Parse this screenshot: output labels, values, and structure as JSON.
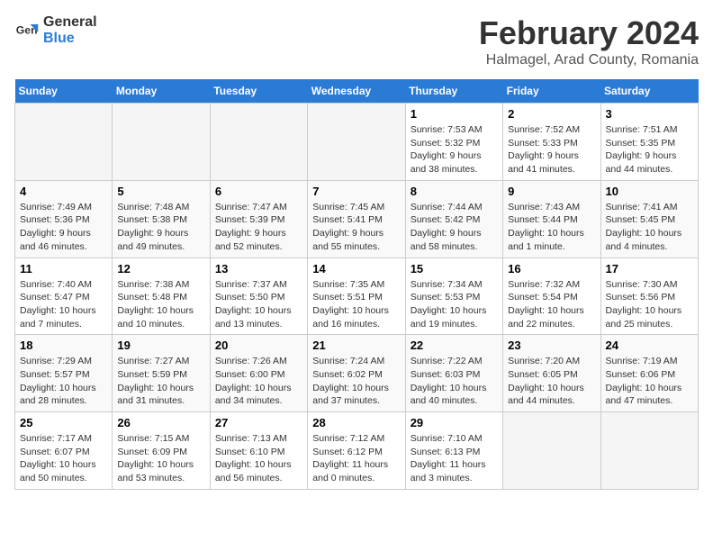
{
  "logo": {
    "line1": "General",
    "line2": "Blue"
  },
  "title": "February 2024",
  "subtitle": "Halmagel, Arad County, Romania",
  "days_of_week": [
    "Sunday",
    "Monday",
    "Tuesday",
    "Wednesday",
    "Thursday",
    "Friday",
    "Saturday"
  ],
  "weeks": [
    [
      {
        "day": "",
        "info": ""
      },
      {
        "day": "",
        "info": ""
      },
      {
        "day": "",
        "info": ""
      },
      {
        "day": "",
        "info": ""
      },
      {
        "day": "1",
        "info": "Sunrise: 7:53 AM\nSunset: 5:32 PM\nDaylight: 9 hours and 38 minutes."
      },
      {
        "day": "2",
        "info": "Sunrise: 7:52 AM\nSunset: 5:33 PM\nDaylight: 9 hours and 41 minutes."
      },
      {
        "day": "3",
        "info": "Sunrise: 7:51 AM\nSunset: 5:35 PM\nDaylight: 9 hours and 44 minutes."
      }
    ],
    [
      {
        "day": "4",
        "info": "Sunrise: 7:49 AM\nSunset: 5:36 PM\nDaylight: 9 hours and 46 minutes."
      },
      {
        "day": "5",
        "info": "Sunrise: 7:48 AM\nSunset: 5:38 PM\nDaylight: 9 hours and 49 minutes."
      },
      {
        "day": "6",
        "info": "Sunrise: 7:47 AM\nSunset: 5:39 PM\nDaylight: 9 hours and 52 minutes."
      },
      {
        "day": "7",
        "info": "Sunrise: 7:45 AM\nSunset: 5:41 PM\nDaylight: 9 hours and 55 minutes."
      },
      {
        "day": "8",
        "info": "Sunrise: 7:44 AM\nSunset: 5:42 PM\nDaylight: 9 hours and 58 minutes."
      },
      {
        "day": "9",
        "info": "Sunrise: 7:43 AM\nSunset: 5:44 PM\nDaylight: 10 hours and 1 minute."
      },
      {
        "day": "10",
        "info": "Sunrise: 7:41 AM\nSunset: 5:45 PM\nDaylight: 10 hours and 4 minutes."
      }
    ],
    [
      {
        "day": "11",
        "info": "Sunrise: 7:40 AM\nSunset: 5:47 PM\nDaylight: 10 hours and 7 minutes."
      },
      {
        "day": "12",
        "info": "Sunrise: 7:38 AM\nSunset: 5:48 PM\nDaylight: 10 hours and 10 minutes."
      },
      {
        "day": "13",
        "info": "Sunrise: 7:37 AM\nSunset: 5:50 PM\nDaylight: 10 hours and 13 minutes."
      },
      {
        "day": "14",
        "info": "Sunrise: 7:35 AM\nSunset: 5:51 PM\nDaylight: 10 hours and 16 minutes."
      },
      {
        "day": "15",
        "info": "Sunrise: 7:34 AM\nSunset: 5:53 PM\nDaylight: 10 hours and 19 minutes."
      },
      {
        "day": "16",
        "info": "Sunrise: 7:32 AM\nSunset: 5:54 PM\nDaylight: 10 hours and 22 minutes."
      },
      {
        "day": "17",
        "info": "Sunrise: 7:30 AM\nSunset: 5:56 PM\nDaylight: 10 hours and 25 minutes."
      }
    ],
    [
      {
        "day": "18",
        "info": "Sunrise: 7:29 AM\nSunset: 5:57 PM\nDaylight: 10 hours and 28 minutes."
      },
      {
        "day": "19",
        "info": "Sunrise: 7:27 AM\nSunset: 5:59 PM\nDaylight: 10 hours and 31 minutes."
      },
      {
        "day": "20",
        "info": "Sunrise: 7:26 AM\nSunset: 6:00 PM\nDaylight: 10 hours and 34 minutes."
      },
      {
        "day": "21",
        "info": "Sunrise: 7:24 AM\nSunset: 6:02 PM\nDaylight: 10 hours and 37 minutes."
      },
      {
        "day": "22",
        "info": "Sunrise: 7:22 AM\nSunset: 6:03 PM\nDaylight: 10 hours and 40 minutes."
      },
      {
        "day": "23",
        "info": "Sunrise: 7:20 AM\nSunset: 6:05 PM\nDaylight: 10 hours and 44 minutes."
      },
      {
        "day": "24",
        "info": "Sunrise: 7:19 AM\nSunset: 6:06 PM\nDaylight: 10 hours and 47 minutes."
      }
    ],
    [
      {
        "day": "25",
        "info": "Sunrise: 7:17 AM\nSunset: 6:07 PM\nDaylight: 10 hours and 50 minutes."
      },
      {
        "day": "26",
        "info": "Sunrise: 7:15 AM\nSunset: 6:09 PM\nDaylight: 10 hours and 53 minutes."
      },
      {
        "day": "27",
        "info": "Sunrise: 7:13 AM\nSunset: 6:10 PM\nDaylight: 10 hours and 56 minutes."
      },
      {
        "day": "28",
        "info": "Sunrise: 7:12 AM\nSunset: 6:12 PM\nDaylight: 11 hours and 0 minutes."
      },
      {
        "day": "29",
        "info": "Sunrise: 7:10 AM\nSunset: 6:13 PM\nDaylight: 11 hours and 3 minutes."
      },
      {
        "day": "",
        "info": ""
      },
      {
        "day": "",
        "info": ""
      }
    ]
  ]
}
